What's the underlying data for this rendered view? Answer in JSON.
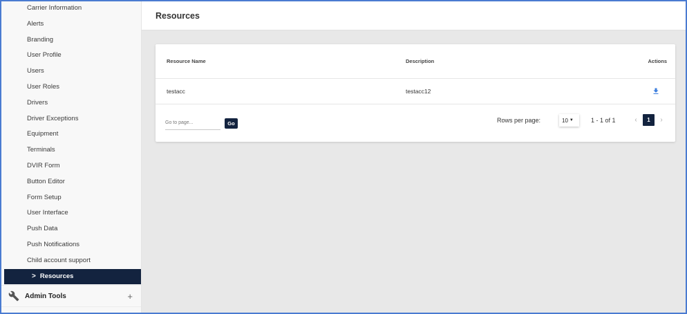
{
  "sidebar": {
    "items": [
      {
        "label": "Carrier Information"
      },
      {
        "label": "Alerts"
      },
      {
        "label": "Branding"
      },
      {
        "label": "User Profile"
      },
      {
        "label": "Users"
      },
      {
        "label": "User Roles"
      },
      {
        "label": "Drivers"
      },
      {
        "label": "Driver Exceptions"
      },
      {
        "label": "Equipment"
      },
      {
        "label": "Terminals"
      },
      {
        "label": "DVIR Form"
      },
      {
        "label": "Button Editor"
      },
      {
        "label": "Form Setup"
      },
      {
        "label": "User Interface"
      },
      {
        "label": "Push Data"
      },
      {
        "label": "Push Notifications"
      },
      {
        "label": "Child account support"
      }
    ],
    "active_item": {
      "label": "Resources",
      "chevron": ">"
    },
    "admin_tools": {
      "label": "Admin Tools",
      "expand": "+",
      "icon": "wrench-icon"
    }
  },
  "header": {
    "title": "Resources"
  },
  "table": {
    "columns": {
      "name": "Resource Name",
      "description": "Description",
      "actions": "Actions"
    },
    "rows": [
      {
        "name": "testacc",
        "description": "testacc12",
        "action_icon": "download-icon"
      }
    ]
  },
  "footer": {
    "goto_placeholder": "Go to page...",
    "go_label": "Go",
    "rows_per_page_label": "Rows per page:",
    "rows_per_page_value": "10",
    "range_text": "1 - 1 of 1",
    "prev": "‹",
    "next": "›",
    "current_page": "1"
  },
  "colors": {
    "accent": "#13233f",
    "download_icon": "#3b7ddd",
    "frame": "#4a7bd1"
  }
}
